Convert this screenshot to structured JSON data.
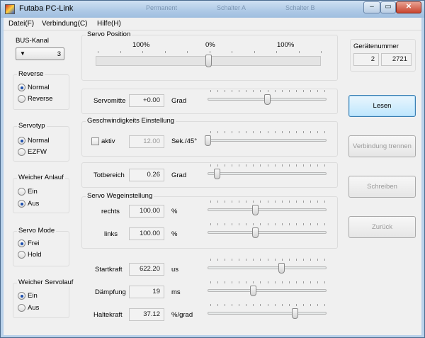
{
  "window": {
    "title": "Futaba PC-Link",
    "ghost_tabs": [
      "Permanent",
      "Schalter A",
      "Schalter B"
    ]
  },
  "menu": [
    "Datei(F)",
    "Verbindung(C)",
    "Hilfe(H)"
  ],
  "bus": {
    "title": "BUS-Kanal",
    "value": "3"
  },
  "reverse": {
    "title": "Reverse",
    "options": [
      "Normal",
      "Reverse"
    ],
    "selected": 0
  },
  "servotyp": {
    "title": "Servotyp",
    "options": [
      "Normal",
      "EZFW"
    ],
    "selected": 0
  },
  "weicher_anlauf": {
    "title": "Weicher Anlauf",
    "options": [
      "Ein",
      "Aus"
    ],
    "selected": 1
  },
  "servo_mode": {
    "title": "Servo Mode",
    "options": [
      "Frei",
      "Hold"
    ],
    "selected": 0
  },
  "weicher_servolauf": {
    "title": "Weicher Servolauf",
    "options": [
      "Ein",
      "Aus"
    ],
    "selected": 0
  },
  "servo_position": {
    "title": "Servo Position",
    "labels": [
      "100%",
      "0%",
      "100%"
    ],
    "level": 0.5
  },
  "servomitte": {
    "label": "Servomitte",
    "value": "+0.00",
    "unit": "Grad",
    "level": 0.5
  },
  "geschwindigkeit": {
    "title": "Geschwindigkeits Einstellung",
    "check_label": "aktiv",
    "checked": false,
    "value": "12.00",
    "unit": "Sek./45°",
    "level": 0.0
  },
  "totbereich": {
    "label": "Totbereich",
    "value": "0.26",
    "unit": "Grad",
    "level": 0.08
  },
  "wegeinstellung": {
    "title": "Servo Wegeinstellung",
    "rechts": {
      "label": "rechts",
      "value": "100.00",
      "unit": "%",
      "level": 0.4
    },
    "links": {
      "label": "links",
      "value": "100.00",
      "unit": "%",
      "level": 0.4
    }
  },
  "startkraft": {
    "label": "Startkraft",
    "value": "622.20",
    "unit": "us",
    "level": 0.62
  },
  "daempfung": {
    "label": "Dämpfung",
    "value": "19",
    "unit": "ms",
    "level": 0.38
  },
  "haltekraft": {
    "label": "Haltekraft",
    "value": "37.12",
    "unit": "%/grad",
    "level": 0.73
  },
  "geraetenummer": {
    "title": "Gerätenummer",
    "part1": "2",
    "part2": "2721"
  },
  "buttons": {
    "lesen": "Lesen",
    "trennen": "Verbindung trennen",
    "schreiben": "Schreiben",
    "zurueck": "Zurück"
  },
  "colors": {
    "accent": "#3c7fb1",
    "radio_dot": "#1c4fae",
    "titlebar": "#aec9e6",
    "close": "#c8452f"
  }
}
